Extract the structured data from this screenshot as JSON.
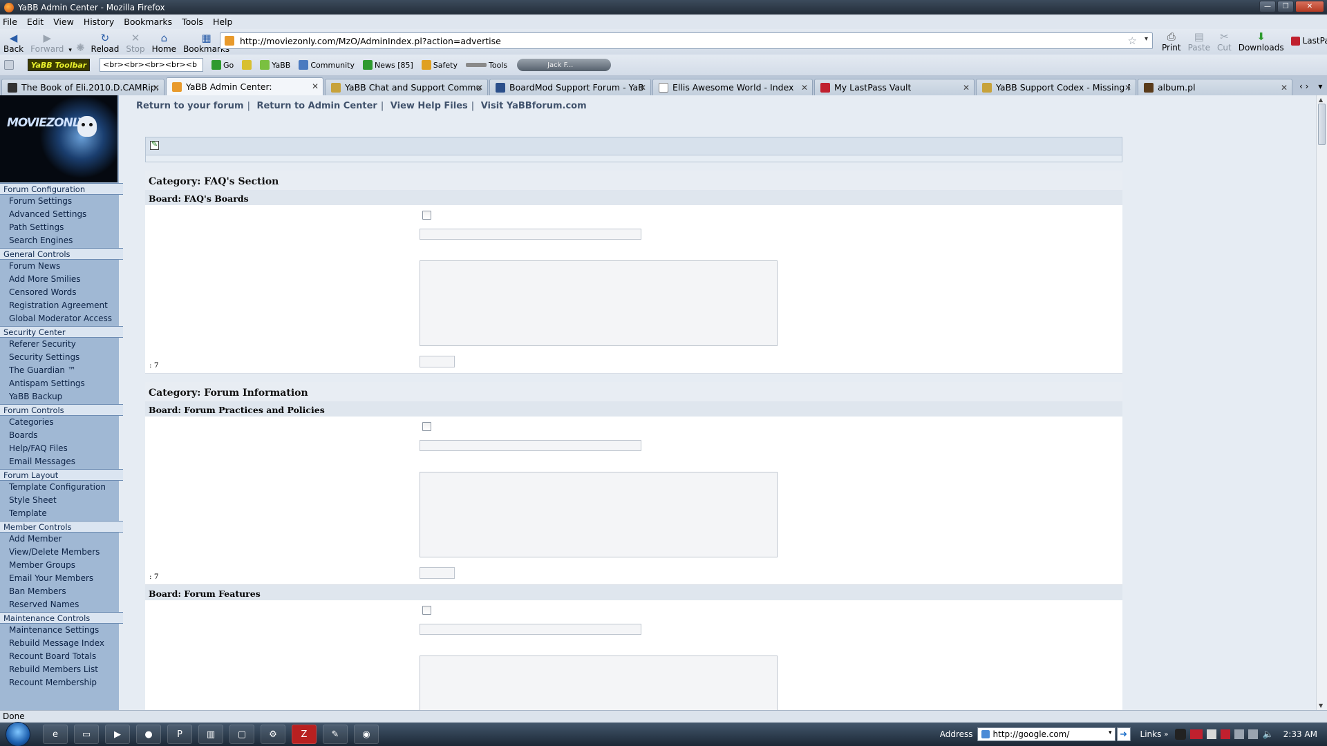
{
  "window": {
    "title": "YaBB Admin Center - Mozilla Firefox"
  },
  "menu": [
    "File",
    "Edit",
    "View",
    "History",
    "Bookmarks",
    "Tools",
    "Help"
  ],
  "nav": {
    "back": "Back",
    "forward": "Forward",
    "reload": "Reload",
    "stop": "Stop",
    "home": "Home",
    "bookmarks": "Bookmarks",
    "url": "http://moviezonly.com/MzO/AdminIndex.pl?action=advertise",
    "print": "Print",
    "paste": "Paste",
    "cut": "Cut",
    "downloads": "Downloads",
    "lastpass": "LastPass"
  },
  "toolbar2": {
    "logo": "YaBB Toolbar",
    "select": "<br><br><br><br><b",
    "go": "Go",
    "yabb": "YaBB",
    "community": "Community",
    "news": "News [85]",
    "safety": "Safety",
    "tools": "Tools",
    "media": "Jack F..."
  },
  "tabs": [
    {
      "label": "The Book of Eli.2010.D.CAMRip....",
      "color": "#333333"
    },
    {
      "label": "YaBB Admin Center:",
      "color": "#e89a2c"
    },
    {
      "label": "YaBB Chat and Support Commu...",
      "color": "#c7a23a"
    },
    {
      "label": "BoardMod Support Forum - YaB...",
      "color": "#2b4f8a"
    },
    {
      "label": "Ellis Awesome World - Index",
      "color": "#ffffff"
    },
    {
      "label": "My LastPass Vault",
      "color": "#c0202e"
    },
    {
      "label": "YaBB Support Codex - Missing P...",
      "color": "#c7a23a"
    },
    {
      "label": "album.pl",
      "color": "#5a3b1a"
    }
  ],
  "sidebar": {
    "logo": "MOVIEZONLY",
    "sections": [
      {
        "title": "Forum Configuration",
        "items": [
          "Forum Settings",
          "Advanced Settings",
          "Path Settings",
          "Search Engines"
        ]
      },
      {
        "title": "General Controls",
        "items": [
          "Forum News",
          "Add More Smilies",
          "Censored Words",
          "Registration Agreement",
          "Global Moderator Access"
        ]
      },
      {
        "title": "Security Center",
        "items": [
          "Referer Security",
          "Security Settings",
          "The Guardian ™",
          "Antispam Settings",
          "YaBB Backup"
        ]
      },
      {
        "title": "Forum Controls",
        "items": [
          "Categories",
          "Boards",
          "Help/FAQ Files",
          "Email Messages"
        ]
      },
      {
        "title": "Forum Layout",
        "items": [
          "Template Configuration",
          "Style Sheet",
          "Template"
        ]
      },
      {
        "title": "Member Controls",
        "items": [
          "Add Member",
          "View/Delete Members",
          "Member Groups",
          "Email Your Members",
          "Ban Members",
          "Reserved Names"
        ]
      },
      {
        "title": "Maintenance Controls",
        "items": [
          "Maintenance Settings",
          "Rebuild Message Index",
          "Recount Board Totals",
          "Rebuild Members List",
          "Recount Membership"
        ]
      }
    ]
  },
  "topnav": [
    "Return to your forum",
    "Return to Admin Center",
    "View Help Files",
    "Visit YaBBforum.com"
  ],
  "content": {
    "cat1": "Category: FAQ's Section",
    "board1": "Board: FAQ's Boards",
    "count1": ": 7",
    "cat2": "Category: Forum Information",
    "board2": "Board: Forum Practices and Policies",
    "count2": ": 7",
    "board3": "Board: Forum Features"
  },
  "status": "Done",
  "taskbar": {
    "address_label": "Address",
    "address": "http://google.com/",
    "links": "Links",
    "time": "2:33 AM"
  }
}
